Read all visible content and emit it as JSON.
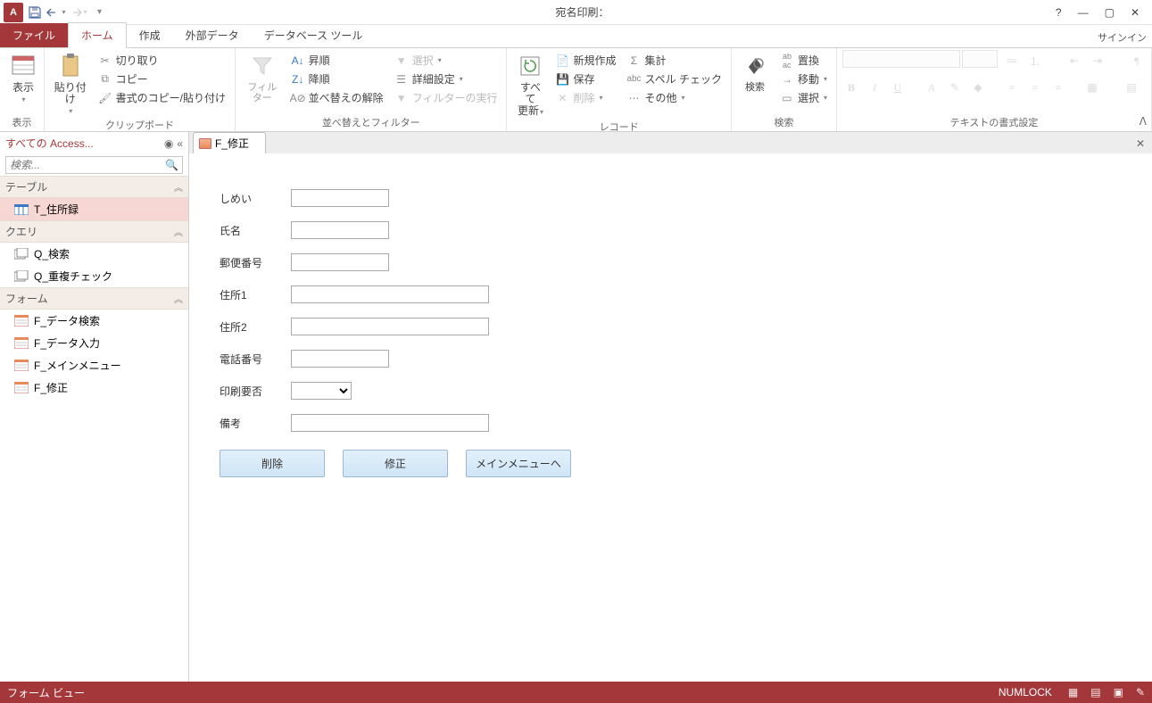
{
  "window": {
    "title": "宛名印刷：",
    "signin": "サインイン"
  },
  "tabs": {
    "file": "ファイル",
    "home": "ホーム",
    "create": "作成",
    "external": "外部データ",
    "dbtools": "データベース ツール"
  },
  "ribbon": {
    "view": "表示",
    "paste": "貼り付け",
    "cut": "切り取り",
    "copy": "コピー",
    "formatpainter": "書式のコピー/貼り付け",
    "clipboard": "クリップボード",
    "filter": "フィルター",
    "asc": "昇順",
    "desc": "降順",
    "clearsort": "並べ替えの解除",
    "selection": "選択",
    "advanced": "詳細設定",
    "togglefilter": "フィルターの実行",
    "sortfilter": "並べ替えとフィルター",
    "refresh_l1": "すべて",
    "refresh_l2": "更新",
    "new": "新規作成",
    "save": "保存",
    "delete": "削除",
    "totals": "集計",
    "spelling": "スペル チェック",
    "more": "その他",
    "records": "レコード",
    "find": "検索",
    "replace": "置換",
    "goto": "移動",
    "select": "選択",
    "findgroup": "検索",
    "textformat": "テキストの書式設定"
  },
  "nav": {
    "header": "すべての Access...",
    "search_ph": "検索...",
    "g_table": "テーブル",
    "t1": "T_住所録",
    "g_query": "クエリ",
    "q1": "Q_検索",
    "q2": "Q_重複チェック",
    "g_form": "フォーム",
    "f1": "F_データ検索",
    "f2": "F_データ入力",
    "f3": "F_メインメニュー",
    "f4": "F_修正"
  },
  "doc": {
    "tab": "F_修正"
  },
  "form": {
    "labels": {
      "shimei": "しめい",
      "shimei_kanji": "氏名",
      "zip": "郵便番号",
      "addr1": "住所1",
      "addr2": "住所2",
      "tel": "電話番号",
      "print": "印刷要否",
      "memo": "備考"
    },
    "buttons": {
      "delete": "削除",
      "update": "修正",
      "menu": "メインメニューへ"
    }
  },
  "status": {
    "left": "フォーム ビュー",
    "numlock": "NUMLOCK"
  }
}
